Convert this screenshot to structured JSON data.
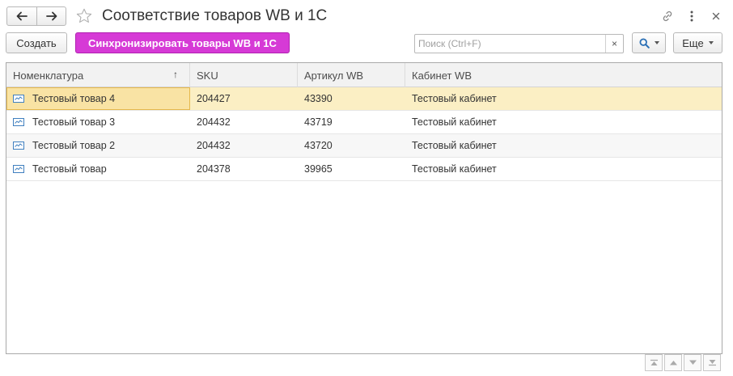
{
  "window": {
    "title": "Соответствие товаров WB и 1С"
  },
  "toolbar": {
    "create_label": "Создать",
    "sync_label": "Синхронизировать товары WB и 1С",
    "search_placeholder": "Поиск (Ctrl+F)",
    "search_clear": "×",
    "more_label": "Еще"
  },
  "table": {
    "columns": [
      "Номенклатура",
      "SKU",
      "Артикул WB",
      "Кабинет WB"
    ],
    "sort_indicator": "↑",
    "rows": [
      {
        "name": "Тестовый товар 4",
        "sku": "204427",
        "article": "43390",
        "cabinet": "Тестовый кабинет"
      },
      {
        "name": "Тестовый товар 3",
        "sku": "204432",
        "article": "43719",
        "cabinet": "Тестовый кабинет"
      },
      {
        "name": "Тестовый товар 2",
        "sku": "204432",
        "article": "43720",
        "cabinet": "Тестовый кабинет"
      },
      {
        "name": "Тестовый товар",
        "sku": "204378",
        "article": "39965",
        "cabinet": "Тестовый кабинет"
      }
    ],
    "selected_row": 0
  },
  "colors": {
    "accent_primary": "#d63ad6",
    "selected_row": "#fbefc4",
    "selected_cell_border": "#e6b84c"
  },
  "icons": {
    "back": "arrow-left-icon",
    "forward": "arrow-right-icon",
    "favorite": "star-icon",
    "link": "link-icon",
    "menu": "more-vertical-icon",
    "close": "close-icon",
    "search": "search-icon",
    "item": "catalog-item-icon"
  }
}
